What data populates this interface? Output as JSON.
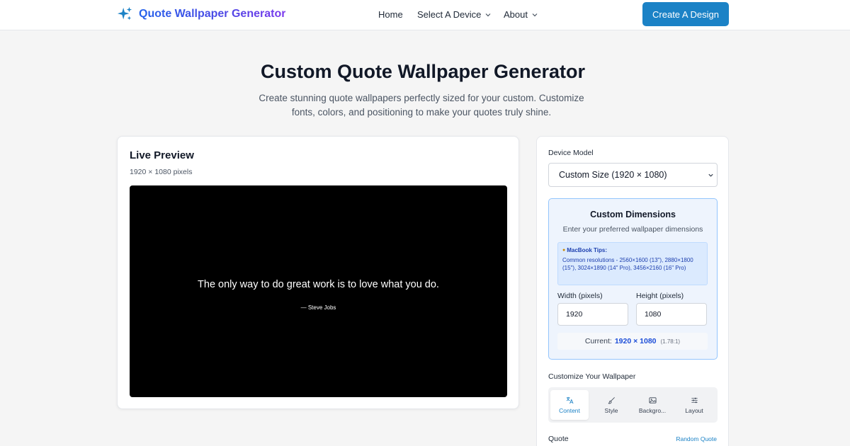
{
  "header": {
    "brand": "Quote Wallpaper Generator",
    "nav": [
      {
        "label": "Home",
        "icon": null
      },
      {
        "label": "Select A Device",
        "icon": "chevron-down-icon"
      },
      {
        "label": "About",
        "icon": "chevron-down-icon"
      }
    ],
    "cta_label": "Create A Design",
    "brand_icon": "sparkles-icon"
  },
  "hero": {
    "title": "Custom Quote Wallpaper Generator",
    "subtitle": "Create stunning quote wallpapers perfectly sized for your custom. Customize fonts, colors, and positioning to make your quotes truly shine."
  },
  "preview": {
    "title": "Live Preview",
    "dimensions": "1920 × 1080 pixels",
    "quote": "The only way to do great work is to love what you do.",
    "author": "— Steve Jobs",
    "background_color": "#000000"
  },
  "settings": {
    "device_label": "Device Model",
    "device_value": "Custom Size (1920 × 1080)",
    "custom": {
      "title": "Custom Dimensions",
      "subtitle": "Enter your preferred wallpaper dimensions",
      "tips_title": "MacBook Tips:",
      "tips_body": "Common resolutions - 2560×1600 (13\"), 2880×1800 (15\"), 3024×1890 (14\" Pro), 3456×2160 (16\" Pro)",
      "width_label": "Width (pixels)",
      "width_value": "1920",
      "height_label": "Height (pixels)",
      "height_value": "1080",
      "current_label": "Current:",
      "current_value": "1920 × 1080",
      "current_ratio": "(1.78:1)"
    },
    "customize_label": "Customize Your Wallpaper",
    "tabs": [
      {
        "label": "Content",
        "icon": "translate-icon",
        "active": true
      },
      {
        "label": "Style",
        "icon": "brush-icon",
        "active": false
      },
      {
        "label": "Backgro...",
        "icon": "image-icon",
        "active": false
      },
      {
        "label": "Layout",
        "icon": "sliders-icon",
        "active": false
      }
    ],
    "quote_label": "Quote",
    "random_label": "Random Quote"
  },
  "colors": {
    "accent": "#1b82c6",
    "brand_gradient_start": "#2563eb",
    "brand_gradient_end": "#7c3aed",
    "page_bg": "#f5f5f5"
  }
}
